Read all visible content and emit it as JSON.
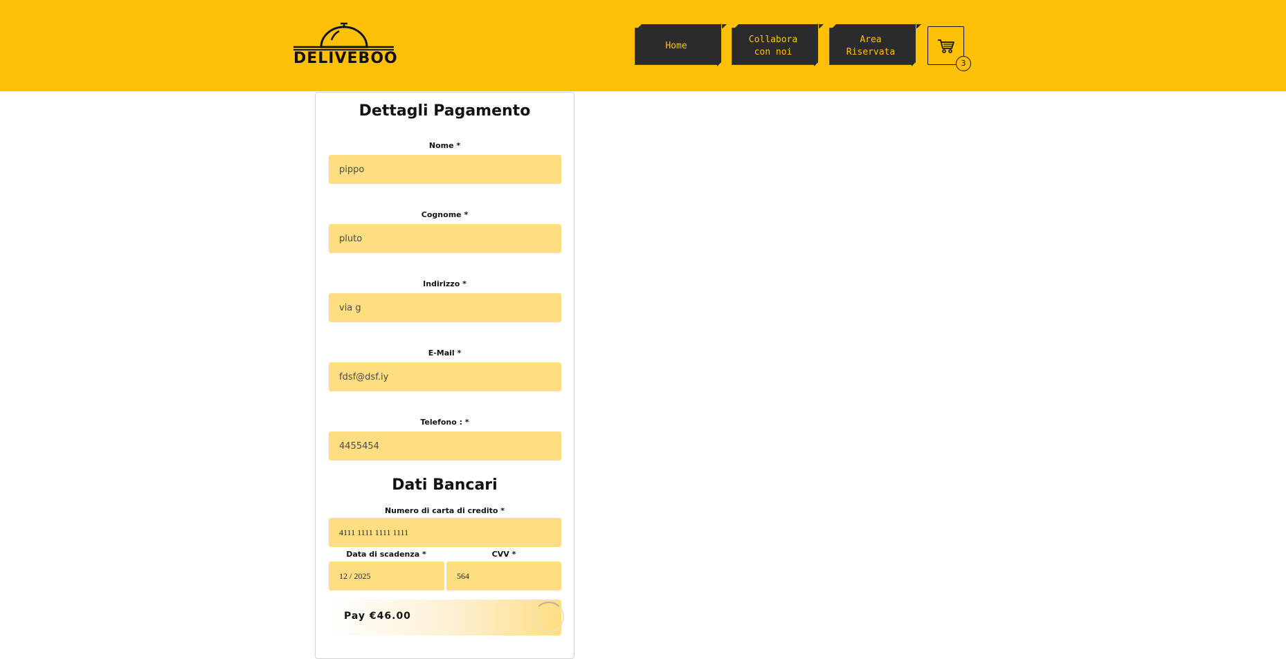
{
  "app": {
    "logo_text": "DELIVEBOO"
  },
  "nav": {
    "items": [
      {
        "label": "Home"
      },
      {
        "label": "Collabora\ncon noi"
      },
      {
        "label": "Area\nRiservata"
      }
    ],
    "cart_count": "3"
  },
  "form": {
    "title": "Dettagli Pagamento",
    "fields": {
      "nome": {
        "label": "Nome *",
        "value": "pippo"
      },
      "cognome": {
        "label": "Cognome *",
        "value": "pluto"
      },
      "indirizzo": {
        "label": "Indirizzo *",
        "value": "via g"
      },
      "email": {
        "label": "E-Mail *",
        "value": "fdsf@dsf.iy"
      },
      "telefono": {
        "label": "Telefono : *",
        "value": "4455454"
      }
    },
    "bank_title": "Dati Bancari",
    "card": {
      "number": {
        "label": "Numero di carta di credito *",
        "value": "4111 1111 1111 1111"
      },
      "expiry": {
        "label": "Data di scadenza *",
        "value": "12 / 2025"
      },
      "cvv": {
        "label": "CVV *",
        "value": "564"
      }
    },
    "pay_label": "Pay €46.00"
  },
  "colors": {
    "header": "#FFC107",
    "field_bg": "#FFDE82",
    "nav_bg": "#2b2b2e"
  }
}
